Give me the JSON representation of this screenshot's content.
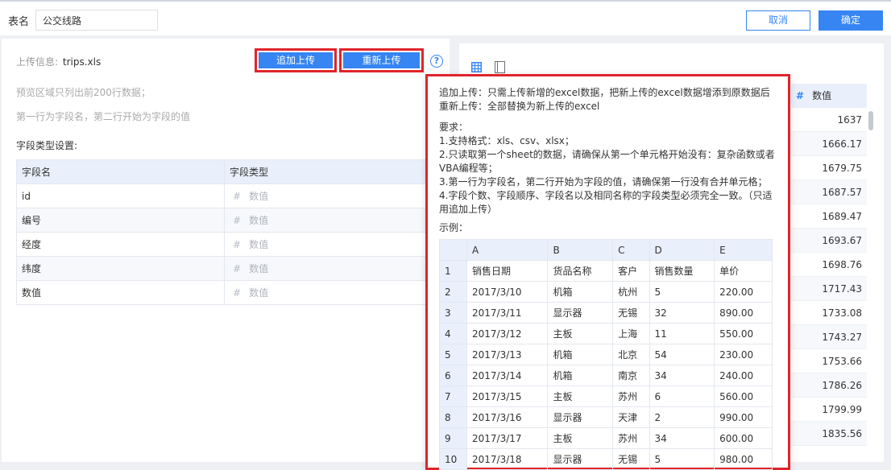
{
  "header": {
    "table_name_label": "表名",
    "table_name_value": "公交线路",
    "cancel_label": "取消",
    "confirm_label": "确定"
  },
  "left": {
    "upload_info_label": "上传信息:",
    "upload_file": "trips.xls",
    "append_upload_label": "追加上传",
    "reupload_label": "重新上传",
    "help_icon": "?",
    "note_preview": "预览区域只列出前200行数据；",
    "note_first_row": "第一行为字段名，第二行开始为字段的值",
    "field_settings_title": "字段类型设置:",
    "field_table": {
      "headers": [
        "字段名",
        "字段类型"
      ],
      "rows": [
        {
          "name": "id",
          "type": "数值"
        },
        {
          "name": "编号",
          "type": "数值"
        },
        {
          "name": "经度",
          "type": "数值"
        },
        {
          "name": "纬度",
          "type": "数值"
        },
        {
          "name": "数值",
          "type": "数值"
        }
      ]
    }
  },
  "preview": {
    "column_header": "数值",
    "values": [
      "1637",
      "1666.17",
      "1679.75",
      "1687.57",
      "1689.47",
      "1693.67",
      "1698.76",
      "1717.43",
      "1733.08",
      "1743.27",
      "1753.66",
      "1786.26",
      "1799.99",
      "1835.56"
    ]
  },
  "popover": {
    "line_append": "追加上传：只需上传新增的excel数据，把新上传的excel数据增添到原数据后",
    "line_reupload": "重新上传：全部替换为新上传的excel",
    "requirements_title": "要求：",
    "req1": "1.支持格式：xls、csv、xlsx；",
    "req2": "2.只读取第一个sheet的数据，请确保从第一个单元格开始没有：复杂函数或者VBA编程等；",
    "req3": "3.第一行为字段名，第二行开始为字段的值，请确保第一行没有合并单元格；",
    "req4": "4.字段个数、字段顺序、字段名以及相同名称的字段类型必须完全一致。（只适用追加上传）",
    "example_title": "示例：",
    "example_table": {
      "columns": [
        "A",
        "B",
        "C",
        "D",
        "E"
      ],
      "rows": [
        {
          "n": "1",
          "cells": [
            "销售日期",
            "货品名称",
            "客户",
            "销售数量",
            "单价"
          ]
        },
        {
          "n": "2",
          "cells": [
            "2017/3/10",
            "机箱",
            "杭州",
            "5",
            "220.00"
          ]
        },
        {
          "n": "3",
          "cells": [
            "2017/3/11",
            "显示器",
            "无锡",
            "32",
            "890.00"
          ]
        },
        {
          "n": "4",
          "cells": [
            "2017/3/12",
            "主板",
            "上海",
            "11",
            "550.00"
          ]
        },
        {
          "n": "5",
          "cells": [
            "2017/3/13",
            "机箱",
            "北京",
            "54",
            "230.00"
          ]
        },
        {
          "n": "6",
          "cells": [
            "2017/3/14",
            "机箱",
            "南京",
            "34",
            "240.00"
          ]
        },
        {
          "n": "7",
          "cells": [
            "2017/3/15",
            "主板",
            "苏州",
            "6",
            "560.00"
          ]
        },
        {
          "n": "8",
          "cells": [
            "2017/3/16",
            "显示器",
            "天津",
            "2",
            "990.00"
          ]
        },
        {
          "n": "9",
          "cells": [
            "2017/3/17",
            "主板",
            "苏州",
            "34",
            "600.00"
          ]
        },
        {
          "n": "10",
          "cells": [
            "2017/3/18",
            "显示器",
            "无锡",
            "5",
            "980.00"
          ]
        }
      ]
    }
  },
  "colors": {
    "primary": "#3685f2",
    "highlight_border": "#e0242b",
    "header_bg": "#e9f0fb"
  }
}
